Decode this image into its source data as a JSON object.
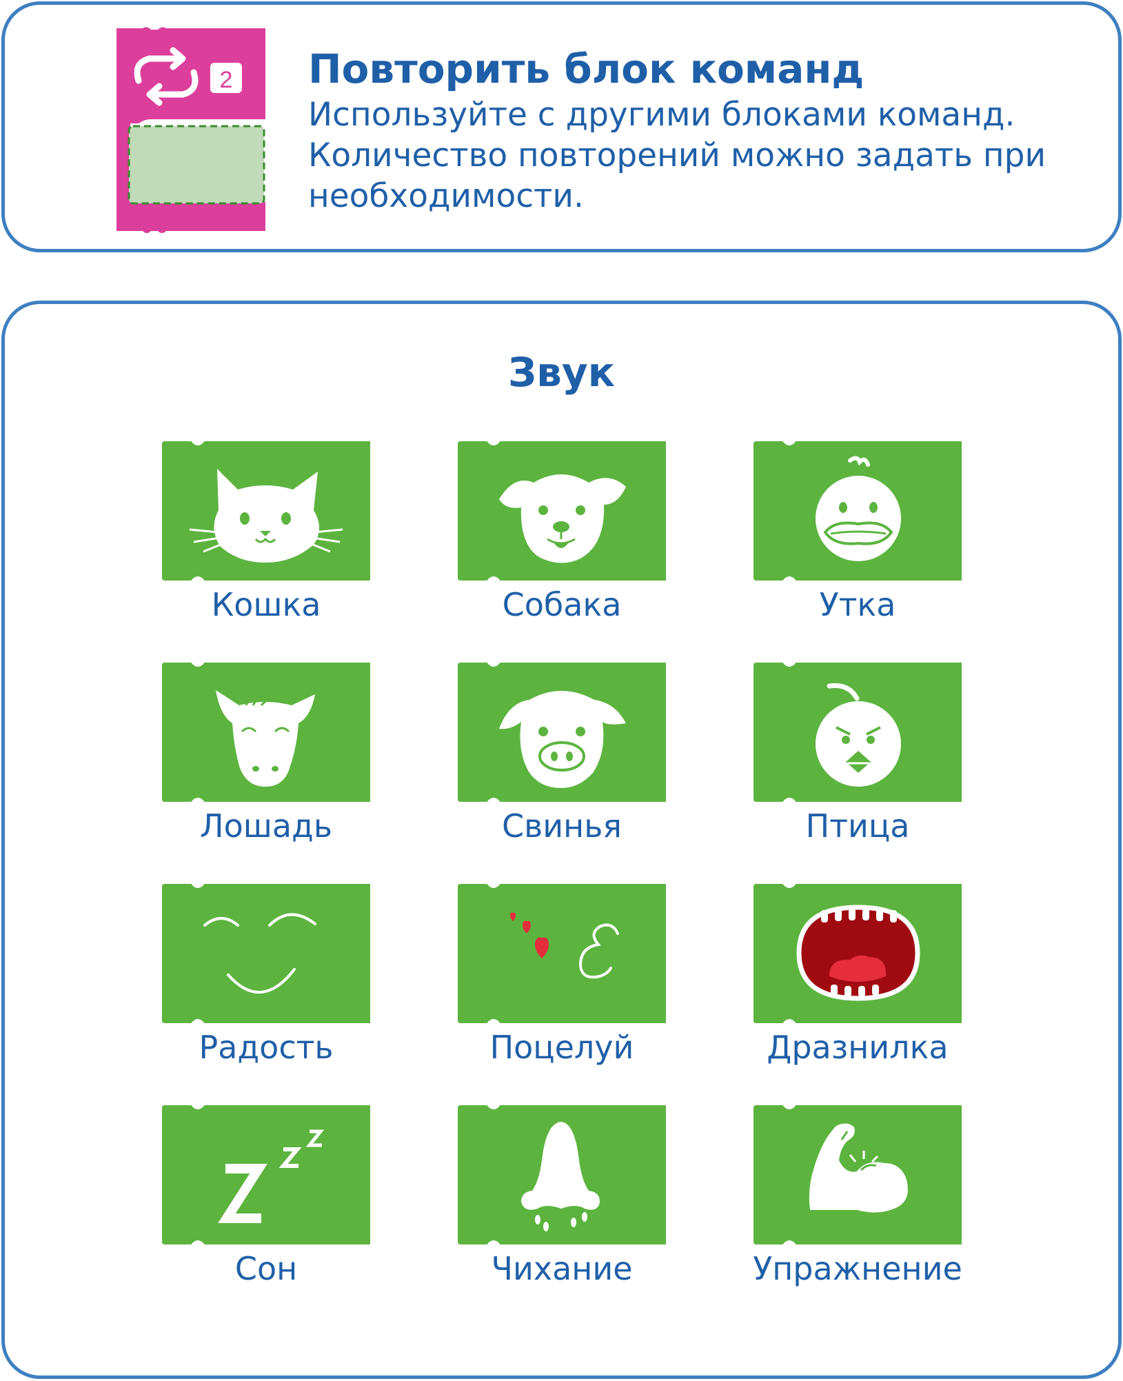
{
  "repeat": {
    "title": "Повторить блок команд",
    "description_lines": [
      "Используйте с другими блоками команд.",
      "Количество повторений можно задать при",
      "необходимости."
    ],
    "count": "2",
    "block_color": "#dc3e9c"
  },
  "sound": {
    "title": "Звук",
    "block_color": "#5cb43f",
    "items": [
      {
        "label": "Кошка",
        "icon": "cat-icon"
      },
      {
        "label": "Собака",
        "icon": "dog-icon"
      },
      {
        "label": "Утка",
        "icon": "duck-icon"
      },
      {
        "label": "Лошадь",
        "icon": "horse-icon"
      },
      {
        "label": "Свинья",
        "icon": "pig-icon"
      },
      {
        "label": "Птица",
        "icon": "bird-icon"
      },
      {
        "label": "Радость",
        "icon": "happy-face-icon"
      },
      {
        "label": "Поцелуй",
        "icon": "kiss-icon"
      },
      {
        "label": "Дразнилка",
        "icon": "tease-mouth-icon"
      },
      {
        "label": "Сон",
        "icon": "sleep-zzz-icon"
      },
      {
        "label": "Чихание",
        "icon": "sneeze-nose-icon"
      },
      {
        "label": "Упражнение",
        "icon": "flexed-arm-icon"
      }
    ]
  },
  "colors": {
    "border": "#3e7fc1",
    "text": "#1f5fa8",
    "repeat_block": "#dc3e9c",
    "sound_block": "#5cb43f",
    "slot_fill": "#c0dbb8",
    "slot_dash": "#3a8a2e",
    "heart": "#e52d3c",
    "mouth": "#a00b12"
  }
}
